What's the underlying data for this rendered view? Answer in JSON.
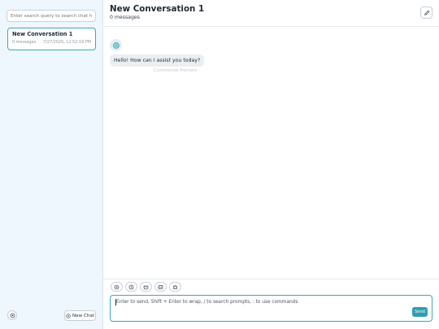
{
  "sidebar": {
    "search_placeholder": "Enter search query to search chat history",
    "conversations": [
      {
        "title": "New Conversation 1",
        "messages": "0 messages",
        "timestamp": "7/27/2025, 12:52:19 PM"
      }
    ],
    "settings_icon": "settings-icon",
    "new_chat_label": "New Chat"
  },
  "header": {
    "title": "New Conversation 1",
    "subtitle": "0 messages",
    "edit_icon": "edit-icon"
  },
  "chat": {
    "assistant_message": "Hello! How can I assist you today?",
    "assistant_icon": "openai-logo-icon",
    "hint": "Commercial Prompts"
  },
  "composer": {
    "tools": [
      "settings-icon",
      "history-icon",
      "mask-icon",
      "code-icon",
      "robot-icon"
    ],
    "placeholder": "Enter to send, Shift + Enter to wrap, / to search prompts, : to use commands",
    "send_label": "Send",
    "accent_color": "#3aa9b9"
  }
}
